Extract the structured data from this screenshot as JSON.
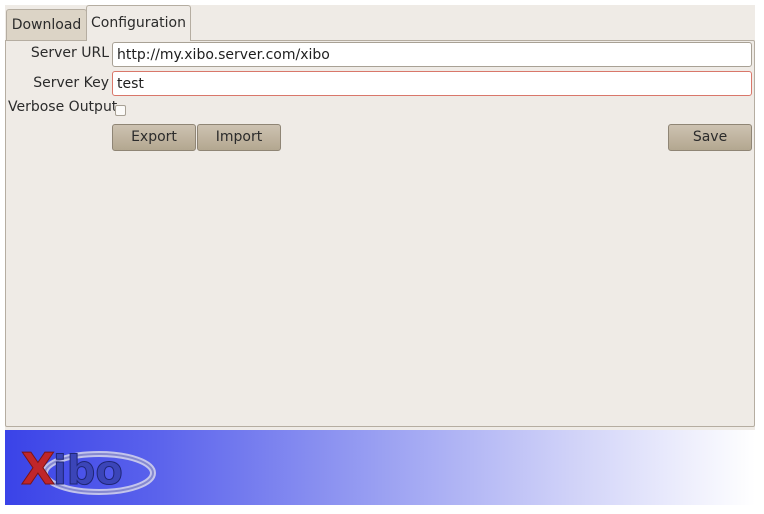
{
  "tabs": [
    {
      "label": "Download",
      "active": false
    },
    {
      "label": "Configuration",
      "active": true
    }
  ],
  "form": {
    "server_url_label": "Server URL",
    "server_url_value": "http://my.xibo.server.com/xibo",
    "server_key_label": "Server Key",
    "server_key_value": "test",
    "verbose_label": "Verbose Output",
    "verbose_checked": false
  },
  "buttons": {
    "export_label": "Export",
    "import_label": "Import",
    "save_label": "Save"
  },
  "banner": {
    "logo_text": "Xibo"
  },
  "colors": {
    "window_bg": "#efebe6",
    "button_bg": "#c2b7a4",
    "banner_start": "#3a43e8",
    "logo_red": "#c0262a",
    "logo_blue": "#3b45b8"
  },
  "icons": [
    "xibo-logo"
  ]
}
